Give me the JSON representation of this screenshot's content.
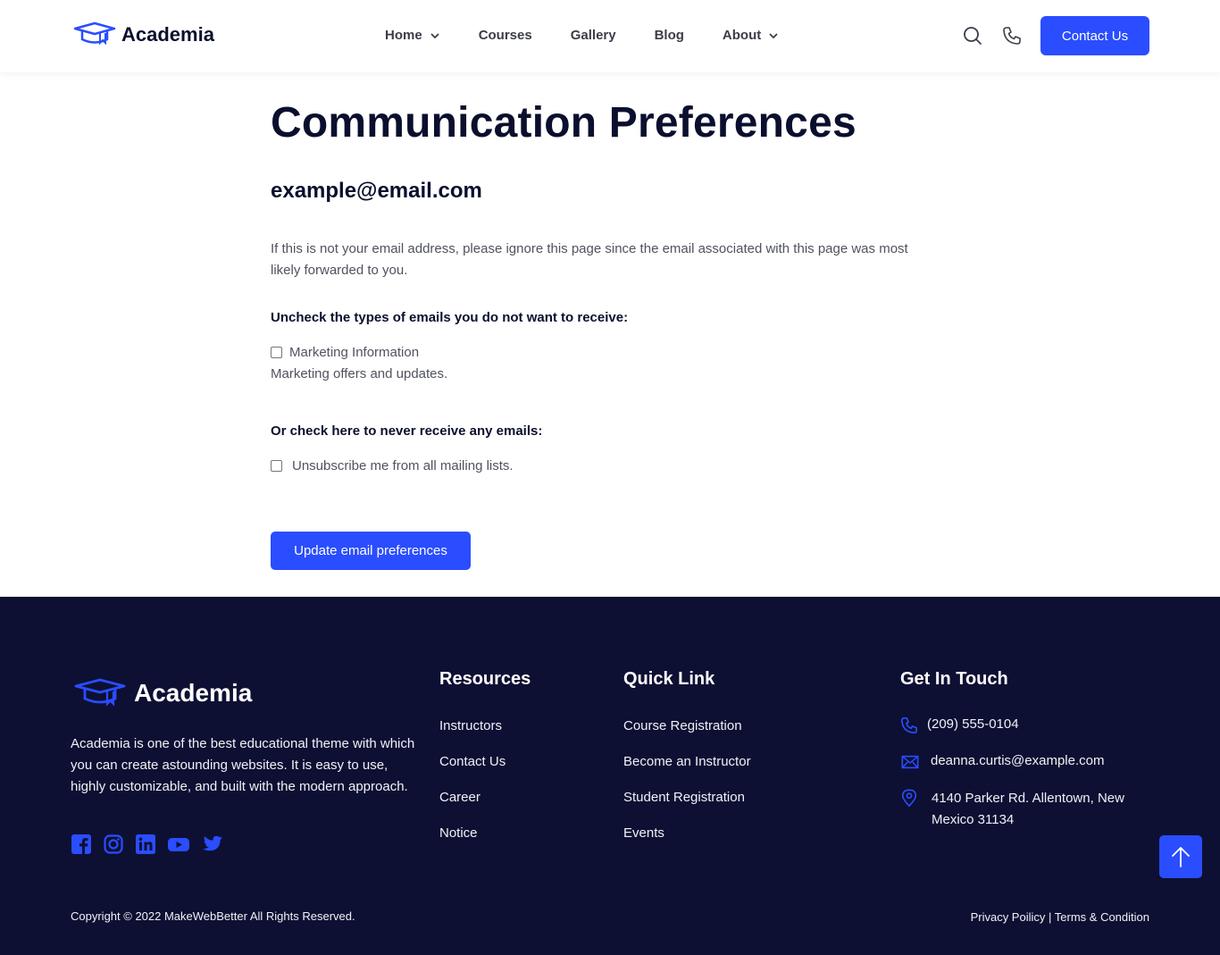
{
  "header": {
    "brand": "Academia",
    "nav": [
      {
        "label": "Home",
        "has_dropdown": true
      },
      {
        "label": "Courses",
        "has_dropdown": false
      },
      {
        "label": "Gallery",
        "has_dropdown": false
      },
      {
        "label": "Blog",
        "has_dropdown": false
      },
      {
        "label": "About",
        "has_dropdown": true
      }
    ],
    "icons": [
      "search-icon",
      "phone-icon"
    ],
    "contact_label": "Contact Us"
  },
  "main": {
    "title": "Communication Preferences",
    "email": "example@email.com",
    "notice": "If this is not your email address, please ignore this page since the email associated with this page was most likely forwarded to you.",
    "uncheck_label": "Uncheck the types of emails you do not want to receive:",
    "option_label": "Marketing Information",
    "option_checked": false,
    "option_desc": "Marketing offers and updates.",
    "never_label": "Or check here to never receive any emails:",
    "unsubscribe_label": "Unsubscribe me from all mailing lists.",
    "unsubscribe_checked": false,
    "update_label": "Update email preferences"
  },
  "footer": {
    "brand": "Academia",
    "about": "Academia is one of the best educational theme with which you can create astounding websites. It is easy to use, highly customizable, and built with the modern approach.",
    "socials": [
      "facebook-icon",
      "instagram-icon",
      "linkedin-icon",
      "youtube-icon",
      "twitter-icon"
    ],
    "resources_title": "Resources",
    "resources": [
      "Instructors",
      "Contact Us",
      "Career",
      "Notice"
    ],
    "quick_title": "Quick Link",
    "quick": [
      "Course Registration",
      "Become an Instructor",
      "Student Registration",
      "Events"
    ],
    "touch_title": "Get In Touch",
    "phone": "(209) 555-0104",
    "email": "deanna.curtis@example.com",
    "address": "4140 Parker Rd. Allentown, New Mexico 31134",
    "copyright": "Copyright © 2022 MakeWebBetter All Rights Reserved.",
    "privacy": "Privacy Poilicy",
    "separator": "|",
    "terms": "Terms & Condition"
  },
  "colors": {
    "accent": "#2a4dff",
    "footer_bg": "#0d1033",
    "heading": "#0b0f2e"
  }
}
